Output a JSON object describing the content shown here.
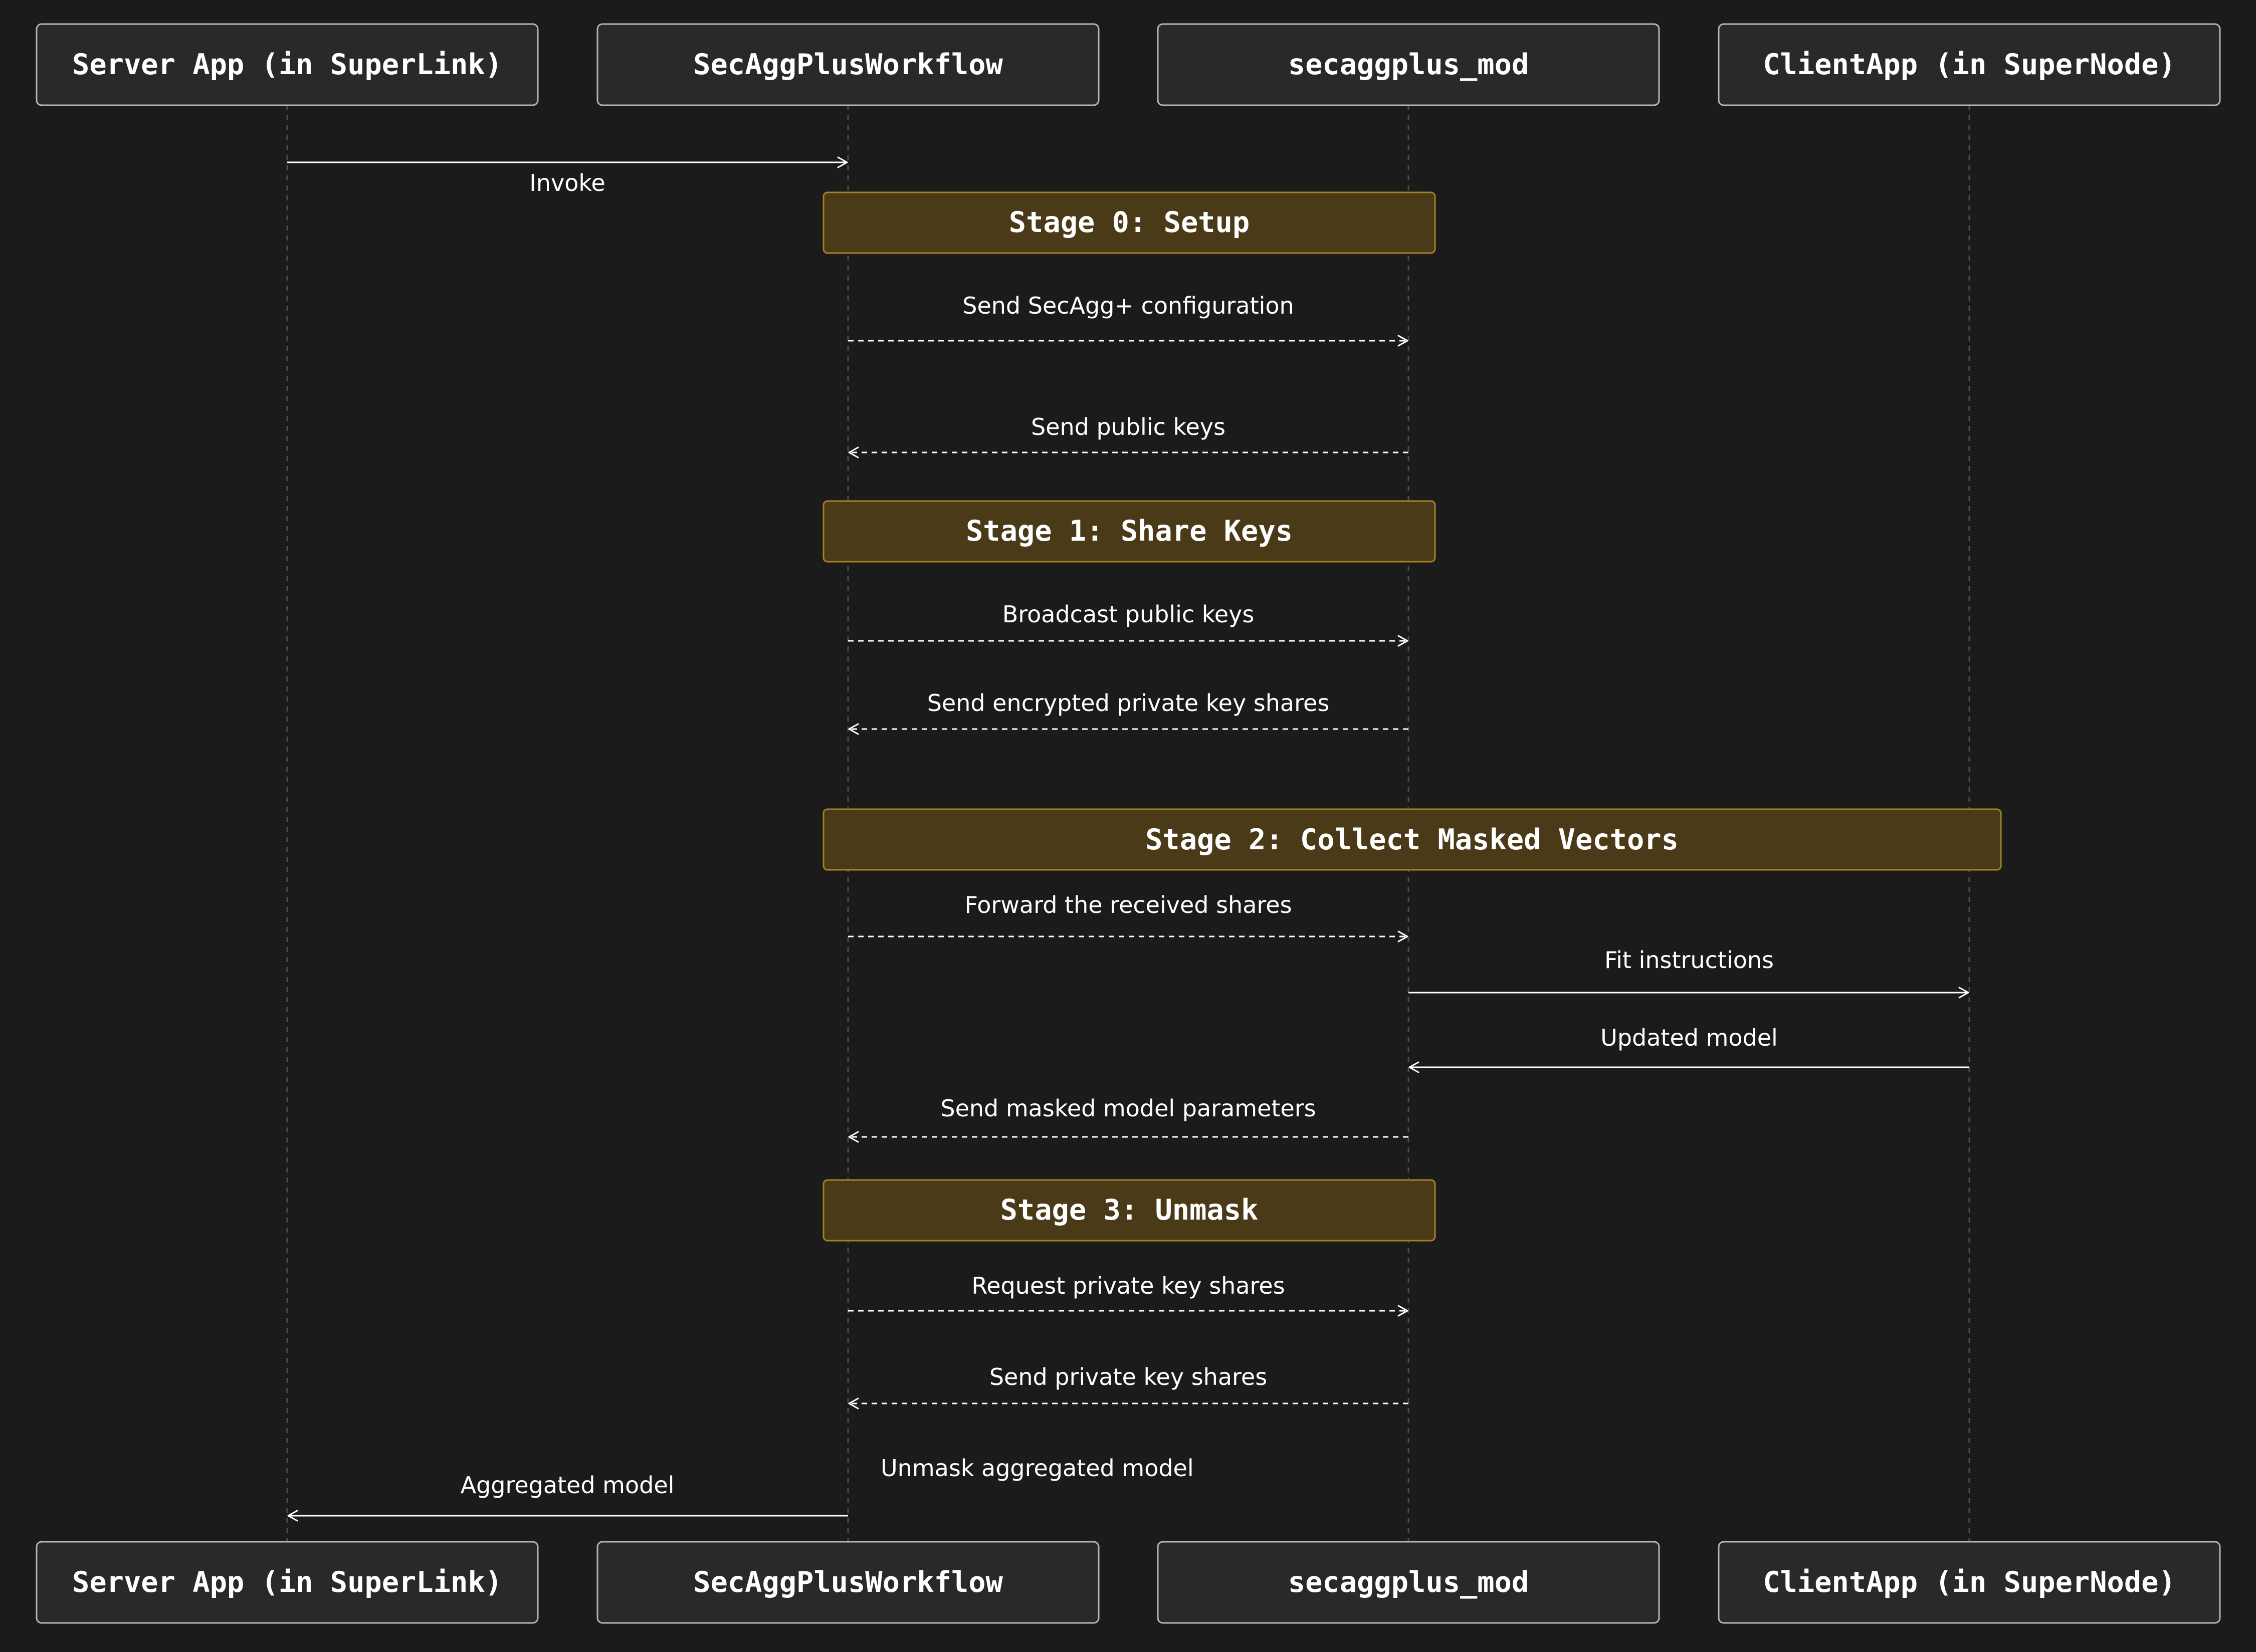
{
  "participants": [
    {
      "id": "server",
      "label": "Server App (in SuperLink)"
    },
    {
      "id": "workflow",
      "label": "SecAggPlusWorkflow"
    },
    {
      "id": "mod",
      "label": "secaggplus_mod"
    },
    {
      "id": "client",
      "label": "ClientApp (in SuperNode)"
    }
  ],
  "sequence": [
    {
      "kind": "message",
      "from": "server",
      "to": "workflow",
      "label": "Invoke",
      "style": "solid"
    },
    {
      "kind": "stage",
      "label": "Stage 0: Setup",
      "span": [
        "workflow",
        "mod"
      ]
    },
    {
      "kind": "message",
      "from": "workflow",
      "to": "mod",
      "label": "Send SecAgg+ configuration",
      "style": "dashed"
    },
    {
      "kind": "message",
      "from": "mod",
      "to": "workflow",
      "label": "Send public keys",
      "style": "dashed"
    },
    {
      "kind": "stage",
      "label": "Stage 1: Share Keys",
      "span": [
        "workflow",
        "mod"
      ]
    },
    {
      "kind": "message",
      "from": "workflow",
      "to": "mod",
      "label": "Broadcast public keys",
      "style": "dashed"
    },
    {
      "kind": "message",
      "from": "mod",
      "to": "workflow",
      "label": "Send encrypted private key shares",
      "style": "dashed"
    },
    {
      "kind": "stage",
      "label": "Stage 2: Collect Masked Vectors",
      "span": [
        "workflow",
        "client"
      ]
    },
    {
      "kind": "message",
      "from": "workflow",
      "to": "mod",
      "label": "Forward the received shares",
      "style": "dashed"
    },
    {
      "kind": "message",
      "from": "mod",
      "to": "client",
      "label": "Fit instructions",
      "style": "solid"
    },
    {
      "kind": "message",
      "from": "client",
      "to": "mod",
      "label": "Updated model",
      "style": "solid"
    },
    {
      "kind": "message",
      "from": "mod",
      "to": "workflow",
      "label": "Send masked model parameters",
      "style": "dashed"
    },
    {
      "kind": "stage",
      "label": "Stage 3: Unmask",
      "span": [
        "workflow",
        "mod"
      ]
    },
    {
      "kind": "message",
      "from": "workflow",
      "to": "mod",
      "label": "Request private key shares",
      "style": "dashed"
    },
    {
      "kind": "message",
      "from": "mod",
      "to": "workflow",
      "label": "Send private key shares",
      "style": "dashed"
    },
    {
      "kind": "note",
      "at": "workflow",
      "label": "Unmask aggregated model"
    },
    {
      "kind": "message",
      "from": "workflow",
      "to": "server",
      "label": "Aggregated model",
      "style": "solid"
    }
  ]
}
